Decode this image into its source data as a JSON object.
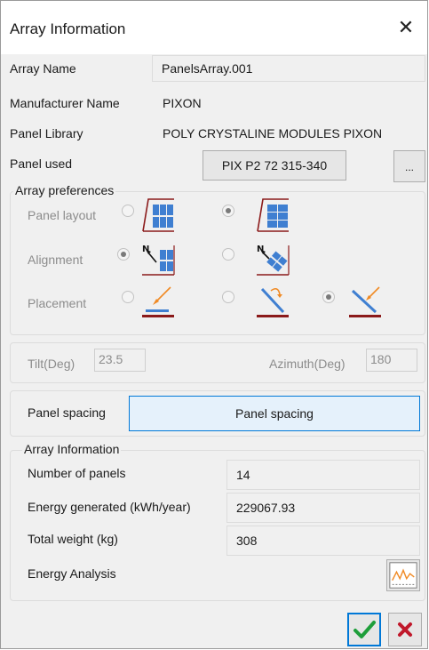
{
  "window": {
    "title": "Array Information",
    "close_glyph": "✕"
  },
  "array_name": {
    "label": "Array Name",
    "value": "PanelsArray.001"
  },
  "manufacturer": {
    "label": "Manufacturer Name",
    "value": "PIXON"
  },
  "panel_library": {
    "label": "Panel Library",
    "value": "POLY CRYSTALINE MODULES PIXON"
  },
  "panel_used": {
    "label": "Panel used",
    "value": "PIX P2 72 315-340",
    "browse_label": "..."
  },
  "preferences": {
    "title": "Array preferences",
    "panel_layout": {
      "label": "Panel layout",
      "options": [
        "portrait-icon",
        "landscape-icon"
      ],
      "selected": 1
    },
    "alignment": {
      "label": "Alignment",
      "options": [
        "north-aligned-icon",
        "rotated-icon"
      ],
      "selected": 0
    },
    "placement": {
      "label": "Placement",
      "options": [
        "flat-icon",
        "tilted-rotate-icon",
        "tilted-icon"
      ],
      "selected": 2
    }
  },
  "angles": {
    "tilt_label": "Tilt(Deg)",
    "tilt_value": "23.5",
    "azimuth_label": "Azimuth(Deg)",
    "azimuth_value": "180"
  },
  "spacing": {
    "label": "Panel spacing",
    "button_label": "Panel spacing"
  },
  "info": {
    "title": "Array Information",
    "number_of_panels": {
      "label": "Number of panels",
      "value": "14"
    },
    "energy_generated": {
      "label": "Energy generated (kWh/year)",
      "value": "229067.93"
    },
    "total_weight": {
      "label": "Total weight (kg)",
      "value": "308"
    },
    "energy_analysis": {
      "label": "Energy Analysis",
      "icon": "chart-icon"
    }
  },
  "colors": {
    "accent": "#0078d7",
    "panel_blue": "#3f7fd1",
    "frame_red": "#8b1a1a",
    "ok_green": "#1e9e3a",
    "cancel_red": "#c0182b",
    "arrow_orange": "#f08a24"
  }
}
